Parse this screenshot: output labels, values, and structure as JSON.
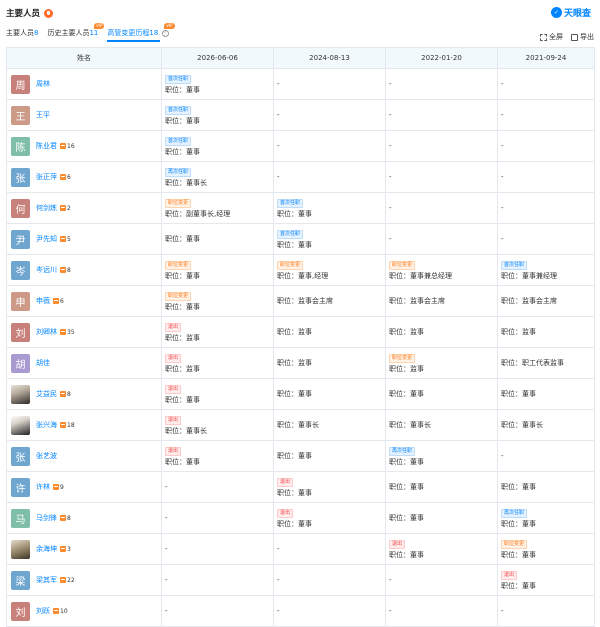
{
  "header": {
    "title": "主要人员",
    "logo_text": "天眼查"
  },
  "tabs": [
    {
      "label": "主要人员",
      "count": "8",
      "active": false,
      "vip": false
    },
    {
      "label": "历史主要人员",
      "count": "11",
      "active": false,
      "vip": true
    },
    {
      "label": "高管变更历程",
      "count": "18",
      "active": true,
      "vip": true
    }
  ],
  "vip_label": "VIP",
  "help_glyph": "?",
  "toolbar": {
    "fullscreen": "全屏",
    "export": "导出"
  },
  "table": {
    "columns": [
      "姓名",
      "2026-06-06",
      "2024-08-13",
      "2022-01-20",
      "2021-09-24"
    ],
    "position_prefix": "职位：",
    "rows": [
      {
        "avatar_char": "周",
        "avatar_color": "#c8807a",
        "name": "周林",
        "count": "",
        "cells": [
          {
            "badge": "首次任职",
            "type": "first",
            "position": "董事"
          },
          {
            "dash": "-"
          },
          {
            "dash": "-"
          },
          {
            "dash": "-"
          }
        ]
      },
      {
        "avatar_char": "王",
        "avatar_color": "#cc9a86",
        "name": "王平",
        "count": "",
        "cells": [
          {
            "badge": "首次任职",
            "type": "first",
            "position": "董事"
          },
          {
            "dash": "-"
          },
          {
            "dash": "-"
          },
          {
            "dash": "-"
          }
        ]
      },
      {
        "avatar_char": "陈",
        "avatar_color": "#7fbfa8",
        "name": "陈业君",
        "count": "16",
        "cells": [
          {
            "badge": "首次任职",
            "type": "first",
            "position": "董事"
          },
          {
            "dash": "-"
          },
          {
            "dash": "-"
          },
          {
            "dash": "-"
          }
        ]
      },
      {
        "avatar_char": "张",
        "avatar_color": "#6fa6cf",
        "name": "张正萍",
        "count": "6",
        "cells": [
          {
            "badge": "再次任职",
            "type": "first",
            "position": "董事长"
          },
          {
            "dash": "-"
          },
          {
            "dash": "-"
          },
          {
            "dash": "-"
          }
        ]
      },
      {
        "avatar_char": "何",
        "avatar_color": "#c8807a",
        "name": "何剑炼",
        "count": "2",
        "cells": [
          {
            "badge": "职位变更",
            "type": "change",
            "position": "副董事长,经理"
          },
          {
            "badge": "首次任职",
            "type": "first",
            "position": "董事"
          },
          {
            "dash": "-"
          },
          {
            "dash": "-"
          }
        ]
      },
      {
        "avatar_char": "尹",
        "avatar_color": "#6fa6cf",
        "name": "尹先知",
        "count": "5",
        "cells": [
          {
            "position": "董事"
          },
          {
            "badge": "首次任职",
            "type": "first",
            "position": "董事"
          },
          {
            "dash": "-"
          },
          {
            "dash": "-"
          }
        ]
      },
      {
        "avatar_char": "岑",
        "avatar_color": "#6fa6cf",
        "name": "岑远川",
        "count": "8",
        "cells": [
          {
            "badge": "职位变更",
            "type": "change",
            "position": "董事"
          },
          {
            "badge": "职位变更",
            "type": "change",
            "position": "董事,经理"
          },
          {
            "badge": "职位变更",
            "type": "change",
            "position": "董事兼总经理"
          },
          {
            "badge": "首次任职",
            "type": "first",
            "position": "董事兼经理"
          }
        ]
      },
      {
        "avatar_char": "申",
        "avatar_color": "#cc9a86",
        "name": "申薇",
        "count": "6",
        "cells": [
          {
            "badge": "职位变更",
            "type": "change",
            "position": "董事"
          },
          {
            "position": "监事会主席"
          },
          {
            "position": "监事会主席"
          },
          {
            "position": "监事会主席"
          }
        ]
      },
      {
        "avatar_char": "刘",
        "avatar_color": "#c8807a",
        "name": "刘卿林",
        "count": "35",
        "cells": [
          {
            "badge": "退出",
            "type": "exit",
            "position": "监事"
          },
          {
            "position": "监事"
          },
          {
            "position": "监事"
          },
          {
            "position": "监事"
          }
        ]
      },
      {
        "avatar_char": "胡",
        "avatar_color": "#a99ad0",
        "name": "胡佳",
        "count": "",
        "cells": [
          {
            "badge": "退出",
            "type": "exit",
            "position": "监事"
          },
          {
            "position": "监事"
          },
          {
            "badge": "职位变更",
            "type": "change",
            "position": "监事"
          },
          {
            "position": "职工代表监事"
          }
        ]
      },
      {
        "avatar_char": "",
        "avatar_color": "",
        "name": "艾益民",
        "count": "8",
        "cells": [
          {
            "badge": "退出",
            "type": "exit",
            "position": "董事"
          },
          {
            "position": "董事"
          },
          {
            "position": "董事"
          },
          {
            "position": "董事"
          }
        ]
      },
      {
        "avatar_char": "",
        "avatar_color": "",
        "name": "张兴海",
        "count": "18",
        "cells": [
          {
            "badge": "退出",
            "type": "exit",
            "position": "董事长"
          },
          {
            "position": "董事长"
          },
          {
            "position": "董事长"
          },
          {
            "position": "董事长"
          }
        ]
      },
      {
        "avatar_char": "张",
        "avatar_color": "#6fa6cf",
        "name": "张艺波",
        "count": "",
        "cells": [
          {
            "badge": "退出",
            "type": "exit",
            "position": "董事"
          },
          {
            "position": "董事"
          },
          {
            "badge": "再次任职",
            "type": "first",
            "position": "董事"
          },
          {
            "dash": "-"
          }
        ]
      },
      {
        "avatar_char": "许",
        "avatar_color": "#6fa6cf",
        "name": "许林",
        "count": "9",
        "cells": [
          {
            "dash": "-"
          },
          {
            "badge": "退出",
            "type": "exit",
            "position": "董事"
          },
          {
            "position": "董事"
          },
          {
            "position": "董事"
          }
        ]
      },
      {
        "avatar_char": "马",
        "avatar_color": "#7fbfa8",
        "name": "马剑锋",
        "count": "8",
        "cells": [
          {
            "dash": "-"
          },
          {
            "badge": "退出",
            "type": "exit",
            "position": "董事"
          },
          {
            "position": "董事"
          },
          {
            "badge": "再次任职",
            "type": "first",
            "position": "董事"
          }
        ]
      },
      {
        "avatar_char": "",
        "avatar_color": "",
        "name": "余海坤",
        "count": "3",
        "cells": [
          {
            "dash": "-"
          },
          {
            "dash": "-"
          },
          {
            "badge": "退出",
            "type": "exit",
            "position": "董事"
          },
          {
            "badge": "职位变更",
            "type": "change",
            "position": "董事"
          }
        ]
      },
      {
        "avatar_char": "梁",
        "avatar_color": "#6fa6cf",
        "name": "梁其军",
        "count": "22",
        "cells": [
          {
            "dash": "-"
          },
          {
            "dash": "-"
          },
          {
            "dash": "-"
          },
          {
            "badge": "退出",
            "type": "exit",
            "position": "董事"
          }
        ]
      },
      {
        "avatar_char": "刘",
        "avatar_color": "#c8807a",
        "name": "刘跃",
        "count": "10",
        "cells": [
          {
            "dash": "-"
          },
          {
            "dash": "-"
          },
          {
            "dash": "-"
          },
          {
            "dash": "-"
          }
        ]
      }
    ]
  }
}
